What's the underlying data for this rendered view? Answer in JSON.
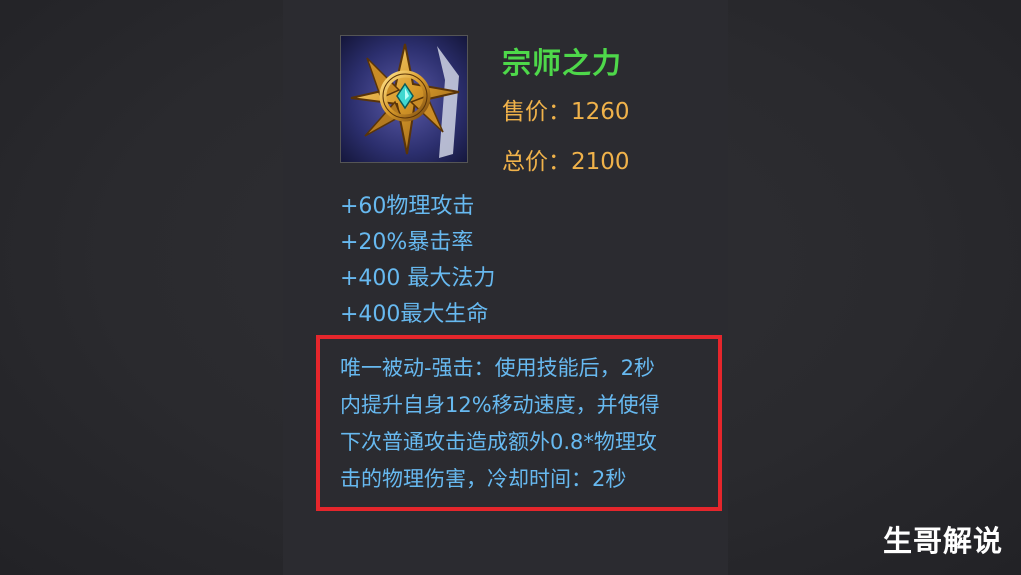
{
  "item": {
    "name": "宗师之力",
    "icon": "golden-star-emblem-icon",
    "sell_price": "售价：1260",
    "total_price": "总价：2100"
  },
  "stats": [
    "+60物理攻击",
    "+20%暴击率",
    "+400 最大法力",
    "+400最大生命"
  ],
  "passive": {
    "lines": [
      "唯一被动-强击：使用技能后，2秒",
      "内提升自身12%移动速度，并使得",
      "下次普通攻击造成额外0.8*物理攻",
      "击的物理伤害，冷却时间：2秒"
    ]
  },
  "watermark": "生哥解说",
  "colors": {
    "name": "#4ed84a",
    "price": "#f0b24a",
    "stat": "#67b9f0",
    "highlight_box": "#e5262c"
  }
}
